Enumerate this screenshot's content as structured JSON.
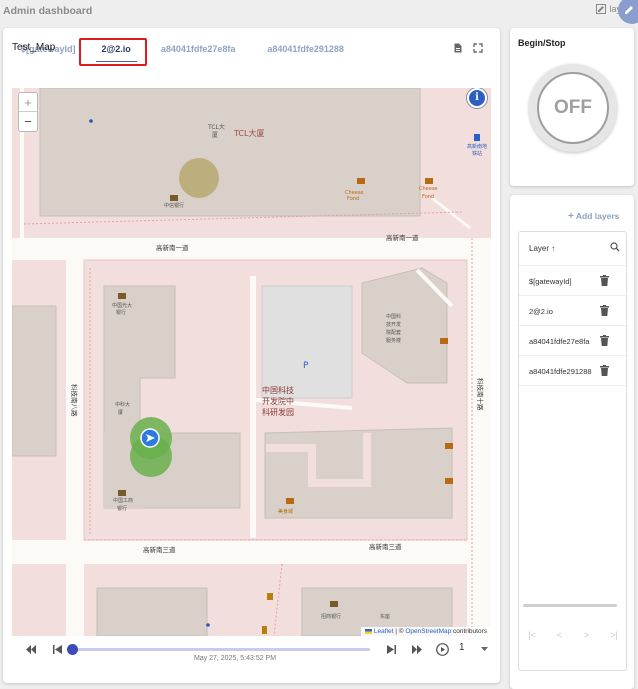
{
  "app": {
    "title": "Admin dashboard",
    "layout_label": "layo"
  },
  "tabs": [
    {
      "label": "$[gatewayId]"
    },
    {
      "label": "2@2.io"
    },
    {
      "label": "a84041fdfe27e8fa"
    },
    {
      "label": "a84041fdfe291288"
    }
  ],
  "map": {
    "title": "Test_Map",
    "zoom_in": "+",
    "zoom_out": "−",
    "info": "i",
    "attribution": {
      "leaflet": "Leaflet",
      "separator": " | © ",
      "osm": "OpenStreetMap",
      "suffix": " contributors"
    },
    "labels": {
      "tcl_building_cn": "TCL大厦",
      "tcl_small": "TCL大",
      "tcl_small2": "厦",
      "bank": "中信银行",
      "cheese1": "Cheese",
      "cheese1b": "Fond",
      "cheese2": "Cheese",
      "cheese2b": "Fond",
      "road_top_left": "高新南一道",
      "road_top_right": "高新南一道",
      "metro1": "高新南地",
      "metro2": "铁站",
      "bank2a": "中国光大",
      "bank2b": "银行",
      "right_block1": "中国科",
      "right_block2": "技开发",
      "right_block3": "院配套",
      "right_block4": "服务楼",
      "parking": "P",
      "center1": "中国科技",
      "center2": "开发院中",
      "center3": "科研发园",
      "zhongke1": "中科大",
      "zhongke2": "厦",
      "road_left_vertical": "科技南八路",
      "road_right_vertical": "科技南十路",
      "bank3a": "中国工商",
      "bank3b": "银行",
      "canteen": "美食城",
      "road_bottom_left": "高新南三道",
      "road_bottom_right": "高新南三道",
      "bottom_bank": "招商银行",
      "bottom_east": "东座"
    }
  },
  "playback": {
    "speed": "1",
    "timestamp": "May 27, 2025, 5:43:52 PM",
    "progress": 0.0
  },
  "begin_stop": {
    "title": "Begin/Stop",
    "state": "OFF"
  },
  "layers": {
    "add_label": "Add layers",
    "header_label": "Layer",
    "items": [
      {
        "name": "$[gatewayId]"
      },
      {
        "name": "2@2.io"
      },
      {
        "name": "a84041fdfe27e8fa"
      },
      {
        "name": "a84041fdfe291288"
      }
    ],
    "pager": [
      "|<",
      "<",
      ">",
      ">|"
    ]
  },
  "colors": {
    "accent": "#3b4cb8",
    "highlight": "#e01b1b",
    "tab_inactive": "#8fa3c4",
    "marker": "#2d7be0",
    "accuracy": "#6ab04c"
  }
}
